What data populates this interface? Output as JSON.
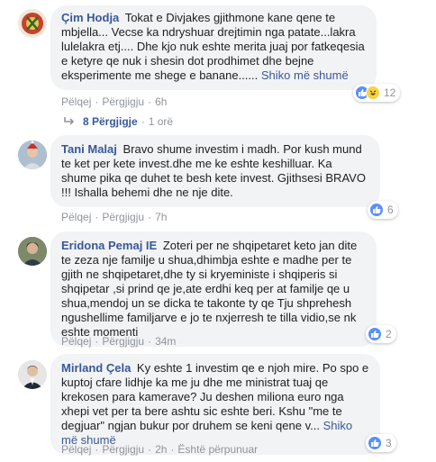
{
  "comments": [
    {
      "author": "Çim Hodja",
      "text": "Tokat e Divjakes gjithmone kane qene te mbjella... Vecse ka ndryshuar drejtimin nga patate...lakra lulelakra etj.... Dhe kjo nuk eshte merita juaj por fatkeqesia e ketyre qe nuk i shesin dot prodhimet dhe bejne eksperimente me shege e banane......",
      "see_more": "Shiko më shumë",
      "like": "Pëlqej",
      "reply": "Përgjigju",
      "time": "6h",
      "reaction_icons": [
        "like-reaction-icon",
        "haha-reaction-icon"
      ],
      "reaction_count": "12",
      "replies_label": "8 Përgjigje",
      "replies_time": "1 orë"
    },
    {
      "author": "Tani Malaj",
      "text": "Bravo shume investim i madh. Por kush mund te ket per kete invest.dhe me ke eshte keshilluar. Ka shume pika qe duhet te besh kete invest. Gjithsesi BRAVO !!! Ishalla behemi dhe ne nje dite.",
      "like": "Pëlqej",
      "reply": "Përgjigju",
      "time": "7h",
      "reaction_count": "6"
    },
    {
      "author": "Eridona Pemaj IE",
      "text": "Zoteri per ne shqipetaret keto jan dite te zeza nje familje u shua,dhimbja eshte e madhe per te gjith ne shqipetaret,dhe ty si kryeministe i shqiperis si shqipetar ,si prind qe je,ate erdhi keq per at familje qe u shua,mendoj un se dicka te takonte ty qe Tju shprehesh ngushellime familjarve e jo te nxjerresh te tilla vidio,se nk eshte momenti",
      "like": "Pëlqej",
      "reply": "Përgjigju",
      "time": "34m",
      "reaction_count": "2"
    },
    {
      "author": "Mirland Çela",
      "text": "Ky eshte 1 investim qe e njoh mire. Po spo e kuptoj cfare lidhje ka me ju dhe me ministrat tuaj qe krekosen para kamerave? Ju deshen miliona euro nga xhepi vet per ta bere ashtu sic eshte beri. Kshu \"me te degjuar\" ngjan bukur por druhem se keni qene v...",
      "see_more": "Shiko më shumë",
      "like": "Pëlqej",
      "reply": "Përgjigju",
      "time": "2h",
      "edited": "Është përpunuar",
      "reaction_count": "3"
    }
  ],
  "colors": {
    "link": "#385898",
    "meta": "#90949c",
    "bubble": "#f2f3f5",
    "like": "#5890ff",
    "haha": "#f7d33f"
  }
}
